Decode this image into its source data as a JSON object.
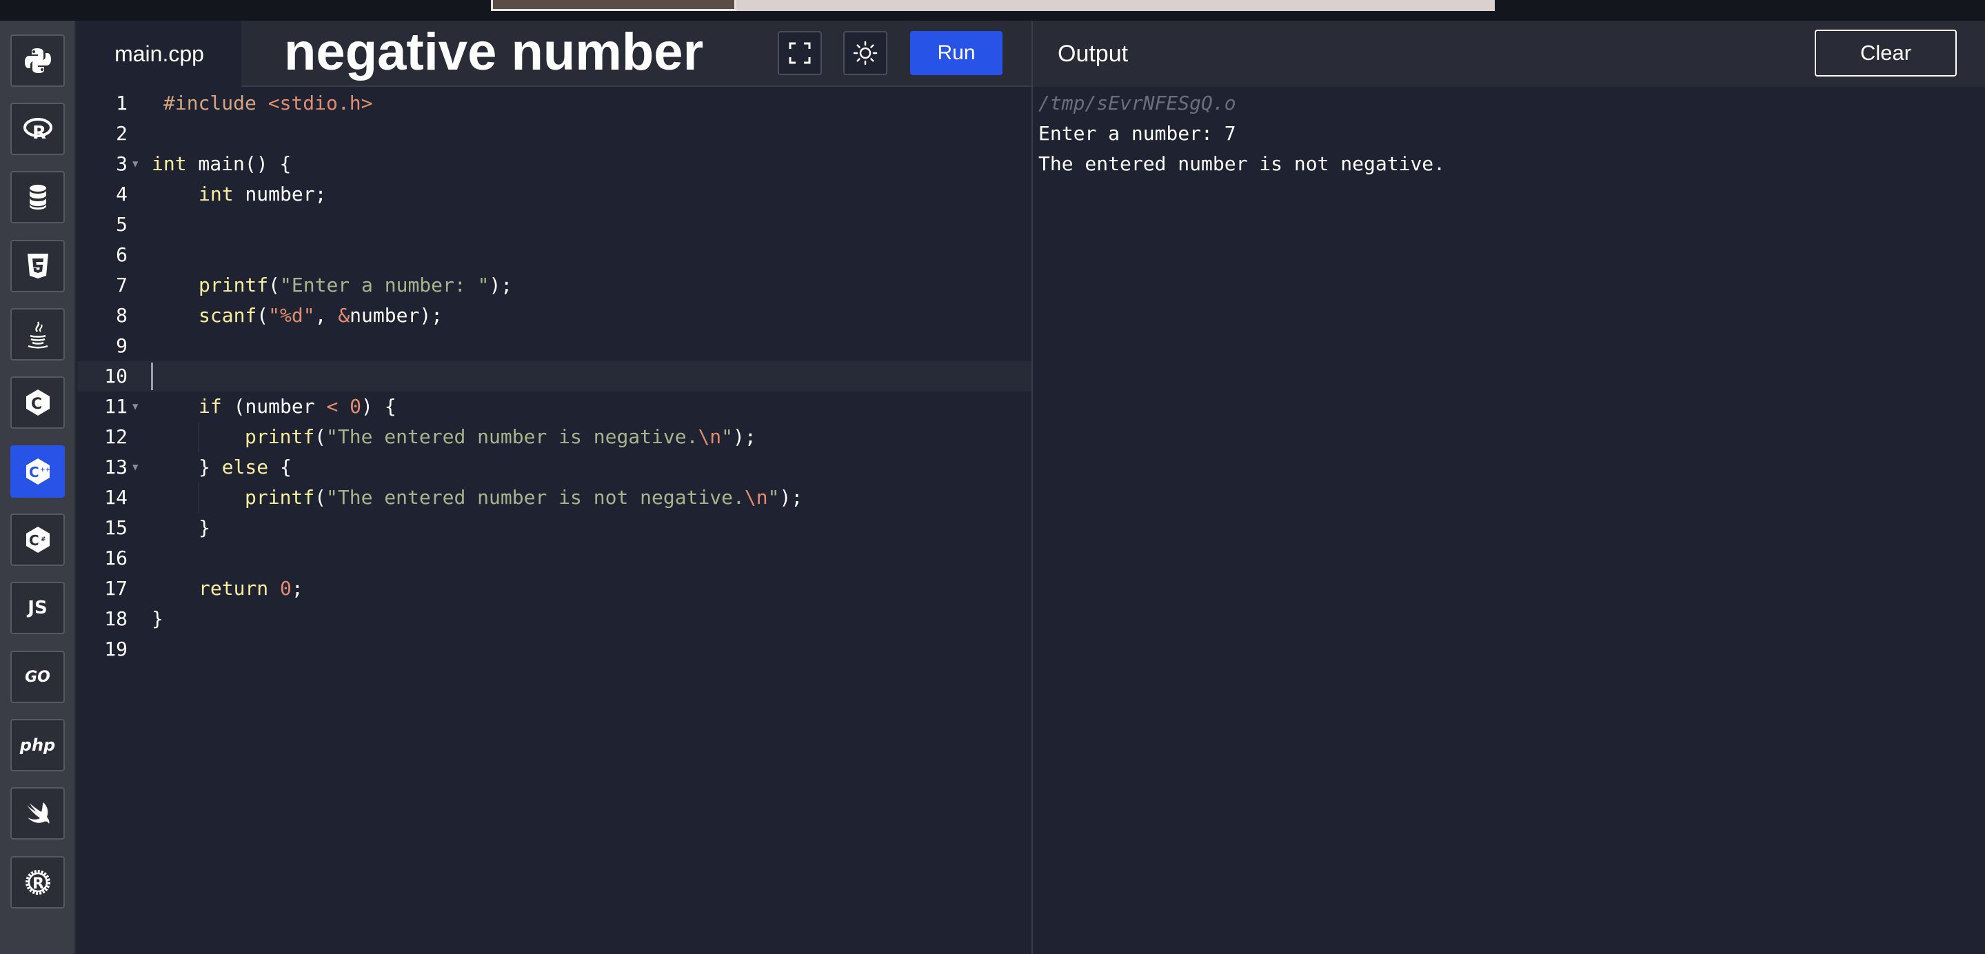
{
  "sidebar": {
    "languages": [
      {
        "name": "python",
        "label": ""
      },
      {
        "name": "r",
        "label": ""
      },
      {
        "name": "sql",
        "label": ""
      },
      {
        "name": "html",
        "label": ""
      },
      {
        "name": "java",
        "label": ""
      },
      {
        "name": "c",
        "label": ""
      },
      {
        "name": "cpp",
        "label": "",
        "active": true
      },
      {
        "name": "csharp",
        "label": ""
      },
      {
        "name": "javascript",
        "label": "JS"
      },
      {
        "name": "go",
        "label": "GO"
      },
      {
        "name": "php",
        "label": "php"
      },
      {
        "name": "swift",
        "label": ""
      },
      {
        "name": "rust",
        "label": ""
      }
    ]
  },
  "header": {
    "tab_label": "main.cpp",
    "title": "negative number",
    "fullscreen_icon": "fullscreen-icon",
    "theme_icon": "sun-icon",
    "run_label": "Run"
  },
  "output_panel": {
    "label": "Output",
    "clear_label": "Clear",
    "lines": [
      "/tmp/sEvrNFESgQ.o",
      "Enter a number: 7",
      "The entered number is not negative."
    ]
  },
  "editor": {
    "current_line": 10,
    "lines": [
      {
        "n": "1"
      },
      {
        "n": "2"
      },
      {
        "n": "3"
      },
      {
        "n": "4"
      },
      {
        "n": "5"
      },
      {
        "n": "6"
      },
      {
        "n": "7"
      },
      {
        "n": "8"
      },
      {
        "n": "9"
      },
      {
        "n": "10"
      },
      {
        "n": "11"
      },
      {
        "n": "12"
      },
      {
        "n": "13"
      },
      {
        "n": "14"
      },
      {
        "n": "15"
      },
      {
        "n": "16"
      },
      {
        "n": "17"
      },
      {
        "n": "18"
      },
      {
        "n": "19"
      }
    ],
    "tokens": {
      "l1_pre": "#include ",
      "l1_inc": "<stdio.h>",
      "l3_kw": "int",
      "l3_rest": " main() {",
      "l4_kw": "int",
      "l4_rest": " number;",
      "l7_fn": "printf",
      "l7_open": "(",
      "l7_str": "\"Enter a number: \"",
      "l7_close": ");",
      "l8_fn": "scanf",
      "l8_open": "(",
      "l8_str": "\"%d\"",
      "l8_mid": ", ",
      "l8_amp": "&",
      "l8_rest": "number);",
      "l11_kw": "if",
      "l11_a": " (number ",
      "l11_op": "<",
      "l11_b": " ",
      "l11_num": "0",
      "l11_c": ") {",
      "l12_fn": "printf",
      "l12_open": "(",
      "l12_str": "\"The entered number is negative.",
      "l12_esc": "\\n",
      "l12_str2": "\"",
      "l12_close": ");",
      "l13_a": "} ",
      "l13_kw": "else",
      "l13_b": " {",
      "l14_fn": "printf",
      "l14_open": "(",
      "l14_str": "\"The entered number is not negative.",
      "l14_esc": "\\n",
      "l14_str2": "\"",
      "l14_close": ");",
      "l15": "}",
      "l17_kw": "return",
      "l17_sp": " ",
      "l17_num": "0",
      "l17_semi": ";",
      "l18": "}"
    }
  },
  "colors": {
    "accent": "#2753e6",
    "background": "#1f2230",
    "keyword": "#f7ef9e",
    "string": "#a9b38e",
    "number": "#e28d71"
  }
}
